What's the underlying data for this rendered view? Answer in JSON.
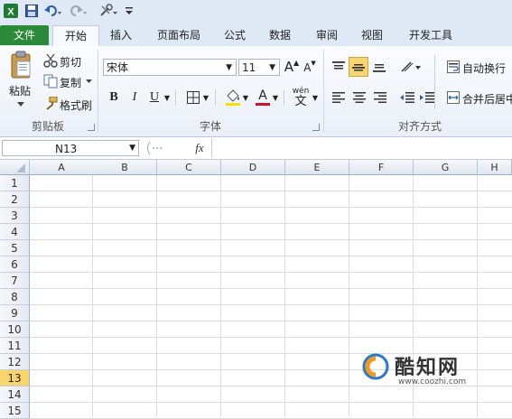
{
  "qat": {
    "undo_icon": "undo-icon",
    "redo_icon": "redo-icon"
  },
  "tabs": [
    "文件",
    "开始",
    "插入",
    "页面布局",
    "公式",
    "数据",
    "审阅",
    "视图",
    "开发工具"
  ],
  "clipboard": {
    "paste_label": "粘贴",
    "cut_label": "剪切",
    "copy_label": "复制",
    "format_painter_label": "格式刷",
    "group_label": "剪贴板"
  },
  "font": {
    "name": "宋体",
    "size": "11",
    "grow_label": "A",
    "shrink_label": "A",
    "bold_label": "B",
    "italic_label": "I",
    "underline_label": "U",
    "font_color_label": "A",
    "phonetic_label": "wén",
    "group_label": "字体"
  },
  "alignment": {
    "wrap_text_label": "自动换行",
    "merge_label": "合并后居中",
    "group_label": "对齐方式"
  },
  "formula_bar": {
    "name_box": "N13",
    "fx_label": "fx",
    "formula": ""
  },
  "sheet": {
    "columns": [
      "A",
      "B",
      "C",
      "D",
      "E",
      "F",
      "G",
      "H"
    ],
    "rows": [
      "1",
      "2",
      "3",
      "4",
      "5",
      "6",
      "7",
      "8",
      "9",
      "10",
      "11",
      "12",
      "13",
      "14",
      "15"
    ],
    "active_row": "13"
  },
  "watermark": {
    "title": "酷知网",
    "url": "www.coozhi.com"
  },
  "colors": {
    "file_tab": "#2a8a3a",
    "active_row_header": "#f9d66c",
    "selected_align_button": "#f7d572",
    "font_color_bar": "#d0121b"
  }
}
